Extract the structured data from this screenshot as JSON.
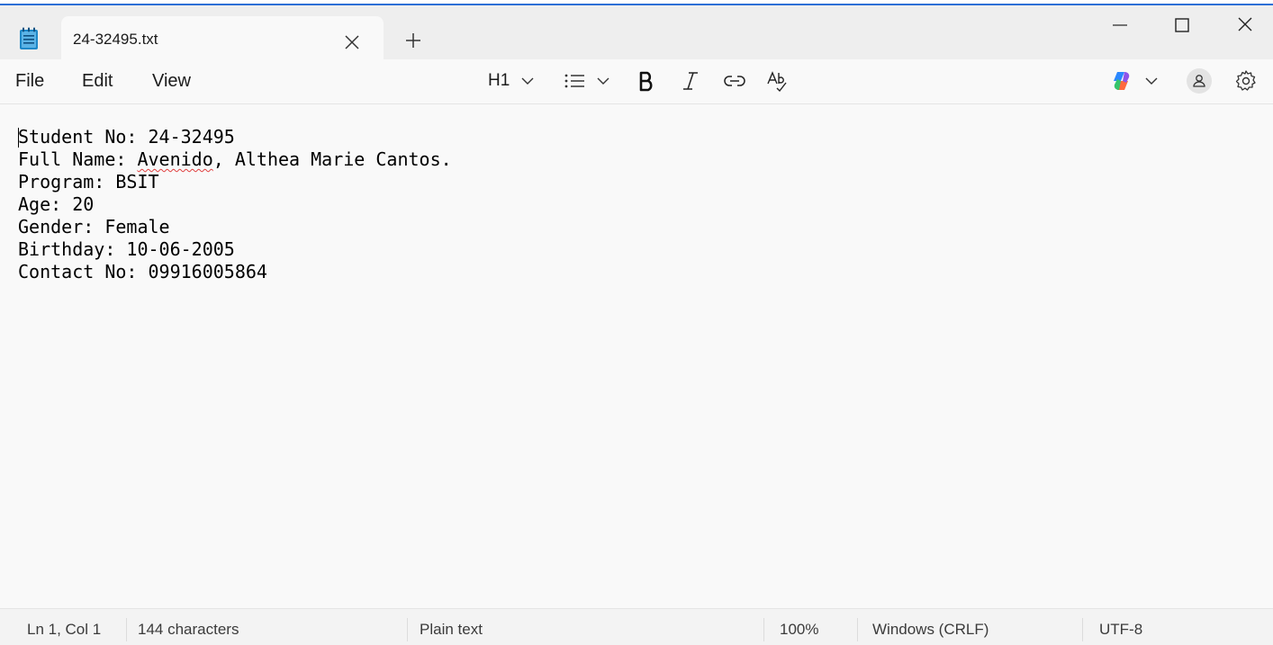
{
  "tab": {
    "title": "24-32495.txt"
  },
  "menu": {
    "file": "File",
    "edit": "Edit",
    "view": "View"
  },
  "toolbar": {
    "heading": "H1"
  },
  "document": {
    "line1": "Student No: 24-32495",
    "line2_prefix": "Full Name: ",
    "line2_misspelled": "Avenido",
    "line2_suffix": ", Althea Marie Cantos.",
    "line3": "Program: BSIT",
    "line4": "Age: 20",
    "line5": "Gender: Female",
    "line6": "Birthday: 10-06-2005",
    "line7": "Contact No: 09916005864"
  },
  "status": {
    "position": "Ln 1, Col 1",
    "characters": "144 characters",
    "format": "Plain text",
    "zoom": "100%",
    "line_endings": "Windows (CRLF)",
    "encoding": "UTF-8"
  },
  "colors": {
    "accent": "#2d6fd6",
    "spellcheck": "#e04040"
  }
}
